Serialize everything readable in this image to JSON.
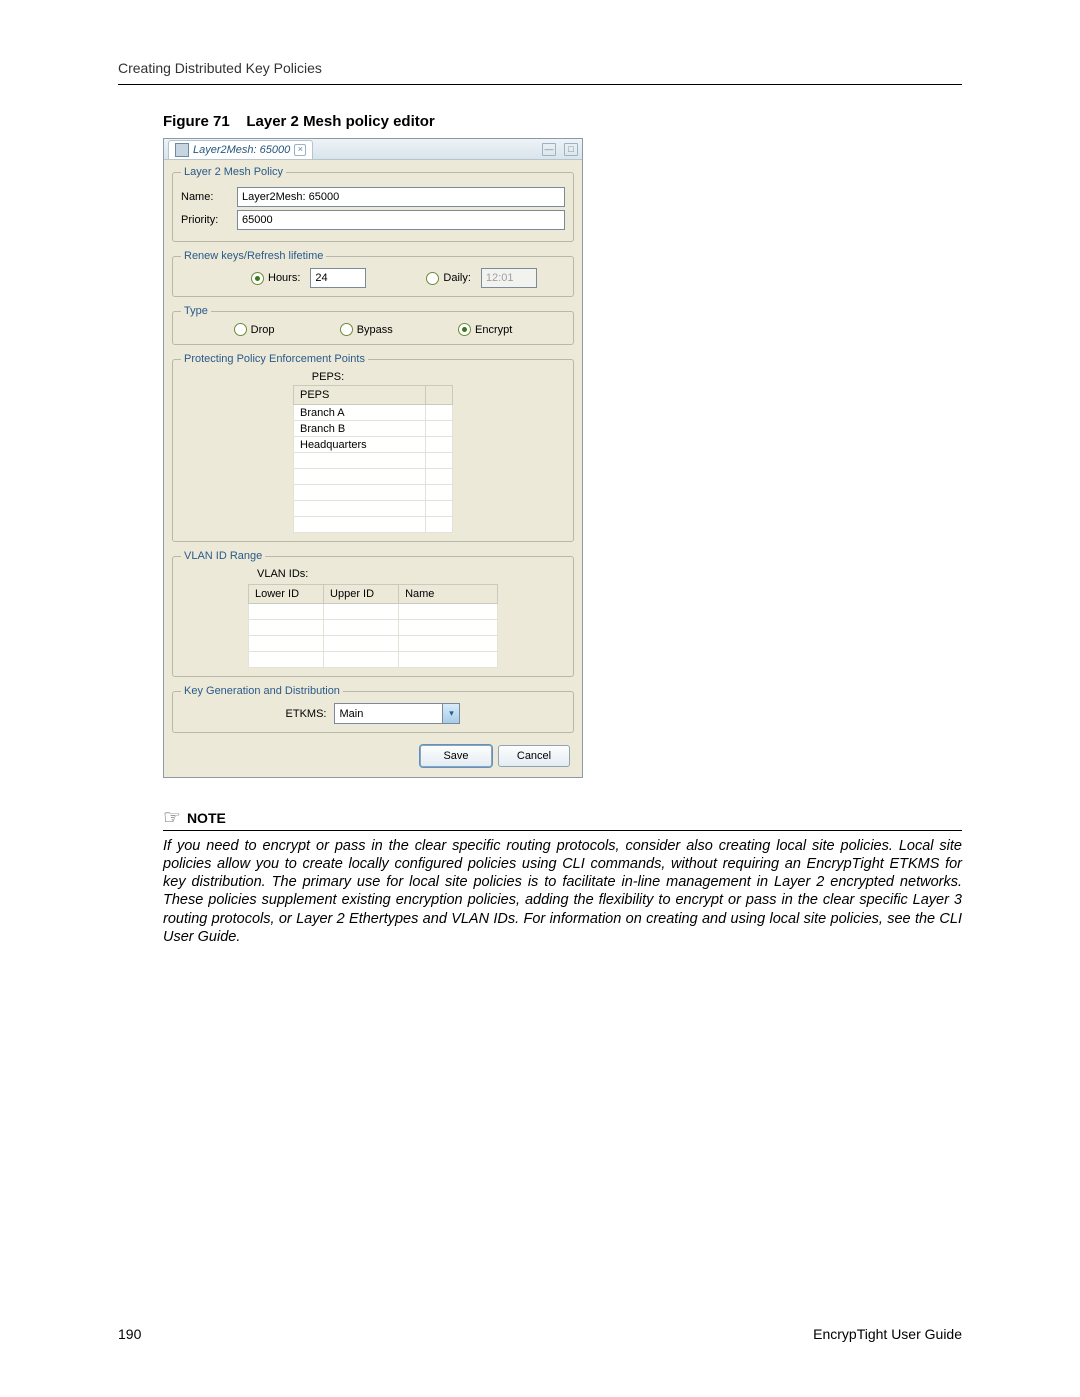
{
  "header": "Creating Distributed Key Policies",
  "figure": {
    "label": "Figure 71",
    "title": "Layer 2 Mesh policy editor"
  },
  "editor": {
    "tab_title": "Layer2Mesh: 65000",
    "policy": {
      "legend": "Layer 2 Mesh Policy",
      "name_label": "Name:",
      "name_value": "Layer2Mesh: 65000",
      "priority_label": "Priority:",
      "priority_value": "65000"
    },
    "renew": {
      "legend": "Renew keys/Refresh lifetime",
      "hours_label": "Hours:",
      "hours_value": "24",
      "daily_label": "Daily:",
      "daily_value": "12:01"
    },
    "type": {
      "legend": "Type",
      "drop": "Drop",
      "bypass": "Bypass",
      "encrypt": "Encrypt"
    },
    "peps": {
      "legend": "Protecting Policy Enforcement Points",
      "label": "PEPS:",
      "col": "PEPS",
      "rows": [
        "Branch A",
        "Branch B",
        "Headquarters"
      ]
    },
    "vlan": {
      "legend": "VLAN ID Range",
      "label": "VLAN IDs:",
      "cols": [
        "Lower ID",
        "Upper ID",
        "Name"
      ]
    },
    "keygen": {
      "legend": "Key Generation and Distribution",
      "label": "ETKMS:",
      "value": "Main"
    },
    "buttons": {
      "save": "Save",
      "cancel": "Cancel"
    }
  },
  "note": {
    "heading": "NOTE",
    "body": "If you need to encrypt or pass in the clear specific routing protocols, consider also creating local site policies. Local site policies allow you to create locally configured policies using CLI commands, without requiring an EncrypTight ETKMS for key distribution. The primary use for local site policies is to facilitate in-line management in Layer 2 encrypted networks. These policies supplement existing encryption policies, adding the flexibility to encrypt or pass in the clear specific Layer 3 routing protocols, or Layer 2 Ethertypes and VLAN IDs. For information on creating and using local site policies, see the CLI User Guide."
  },
  "footer": {
    "page": "190",
    "guide": "EncrypTight User Guide"
  }
}
